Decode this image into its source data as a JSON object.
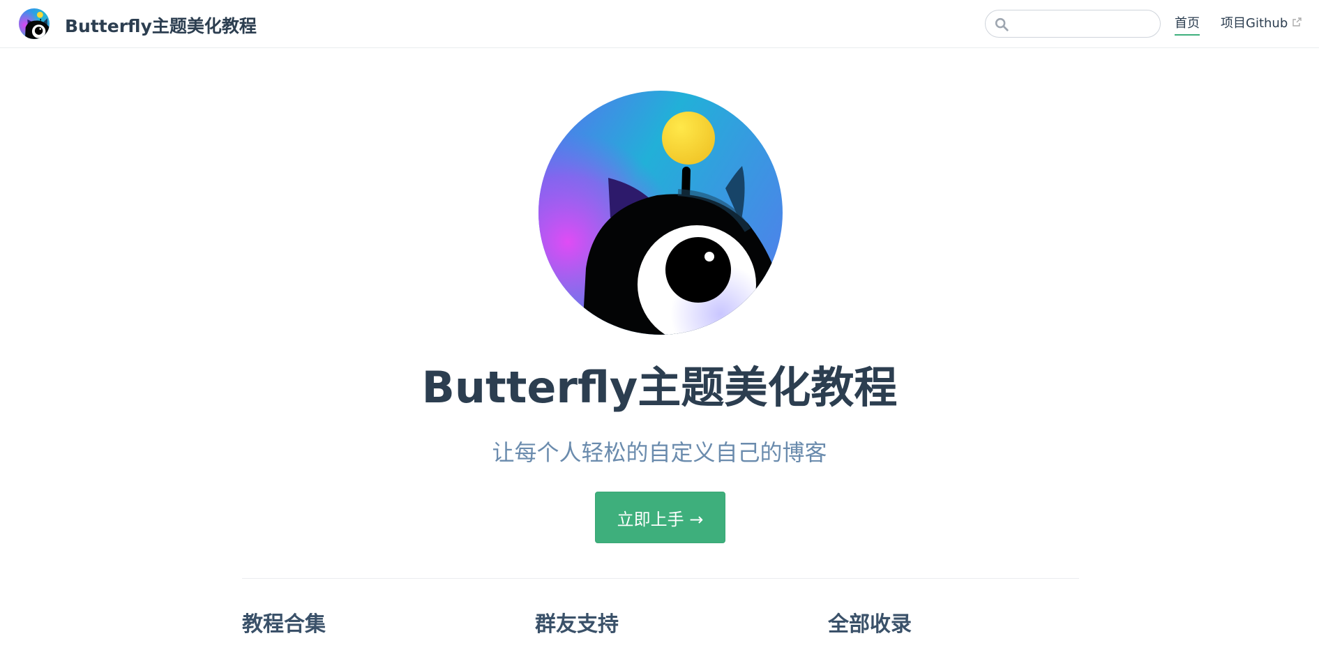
{
  "navbar": {
    "site_name": "Butterfly主题美化教程",
    "search": {
      "placeholder": "",
      "value": ""
    },
    "links": [
      {
        "label": "首页",
        "active": true
      },
      {
        "label": "项目Github",
        "external": true
      }
    ],
    "accent_color": "#3eaf7c"
  },
  "hero": {
    "title": "Butterfly主题美化教程",
    "description": "让每个人轻松的自定义自己的博客",
    "action_label": "立即上手 →",
    "action_color": "#3eaf7c"
  },
  "features": [
    {
      "title": "教程合集"
    },
    {
      "title": "群友支持"
    },
    {
      "title": "全部收录"
    }
  ]
}
